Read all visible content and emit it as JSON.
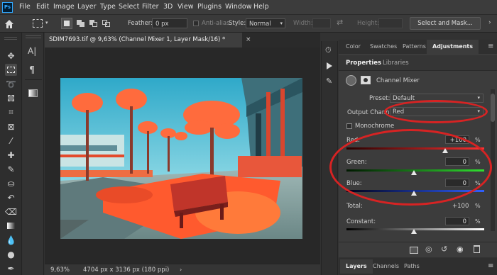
{
  "app": {
    "logo": "Ps"
  },
  "menu": [
    "File",
    "Edit",
    "Image",
    "Layer",
    "Type",
    "Select",
    "Filter",
    "3D",
    "View",
    "Plugins",
    "Window",
    "Help"
  ],
  "options": {
    "feather_label": "Feather:",
    "feather_value": "0 px",
    "antialias_label": "Anti-alias",
    "style_label": "Style:",
    "style_value": "Normal",
    "width_label": "Width:",
    "height_label": "Height:",
    "mask_button": "Select and Mask..."
  },
  "document": {
    "tab_title": "SDIM7693.tif @ 9,63% (Channel Mixer 1, Layer Mask/16) *",
    "zoom": "9,63%",
    "info": "4704 px x 3136 px (180 ppi)"
  },
  "panel_tabs": [
    "Color",
    "Swatches",
    "Patterns",
    "Adjustments"
  ],
  "properties": {
    "tabs": [
      "Properties",
      "Libraries"
    ],
    "title": "Channel Mixer",
    "preset_label": "Preset:",
    "preset_value": "Default",
    "output_label": "Output Channe",
    "output_value": "Red",
    "monochrome_label": "Monochrome",
    "red_label": "Red:",
    "red_value": "+100",
    "red_pct": 100,
    "green_label": "Green:",
    "green_value": "0",
    "green_pct": 0,
    "blue_label": "Blue:",
    "blue_value": "0",
    "blue_pct": 0,
    "total_label": "Total:",
    "total_value": "+100",
    "total_unit": "%",
    "constant_label": "Constant:",
    "constant_value": "0",
    "constant_pct": 0,
    "unit": "%"
  },
  "bottom_tabs": [
    "Layers",
    "Channels",
    "Paths"
  ],
  "colors": {
    "accent": "#1473e6",
    "annotation": "#d72323"
  }
}
